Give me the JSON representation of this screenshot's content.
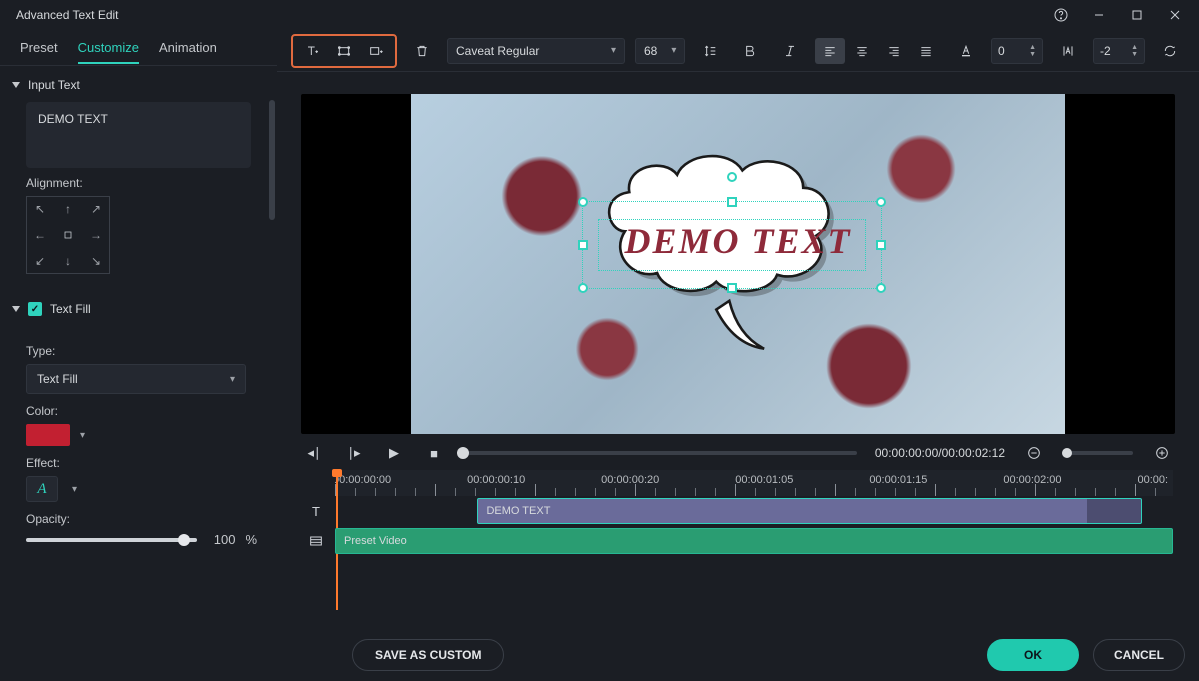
{
  "window": {
    "title": "Advanced Text Edit"
  },
  "sidebar": {
    "tabs": {
      "preset": "Preset",
      "customize": "Customize",
      "animation": "Animation"
    },
    "input_section": "Input Text",
    "demo_text": "DEMO TEXT",
    "alignment_label": "Alignment:",
    "textfill_section": "Text Fill",
    "type_label": "Type:",
    "type_value": "Text Fill",
    "color_label": "Color:",
    "color_hex": "#c22031",
    "effect_label": "Effect:",
    "effect_value": "A",
    "opacity_label": "Opacity:",
    "opacity_value": "100",
    "opacity_unit": "%"
  },
  "toolbar": {
    "font": "Caveat Regular",
    "size": "68",
    "char_spacing": "0",
    "line_spacing": "-2"
  },
  "preview": {
    "overlay_text": "DEMO TEXT",
    "overlay_color": "#8e2a3a"
  },
  "transport": {
    "current": "00:00:00:00",
    "duration": "00:00:02:12"
  },
  "timeline": {
    "labels": [
      "00:00:00:00",
      "00:00:00:10",
      "00:00:00:20",
      "00:00:01:05",
      "00:00:01:15",
      "00:00:02:00",
      "00:00:"
    ],
    "text_clip": "DEMO TEXT",
    "video_clip": "Preset Video"
  },
  "footer": {
    "save": "SAVE AS CUSTOM",
    "ok": "OK",
    "cancel": "CANCEL"
  }
}
